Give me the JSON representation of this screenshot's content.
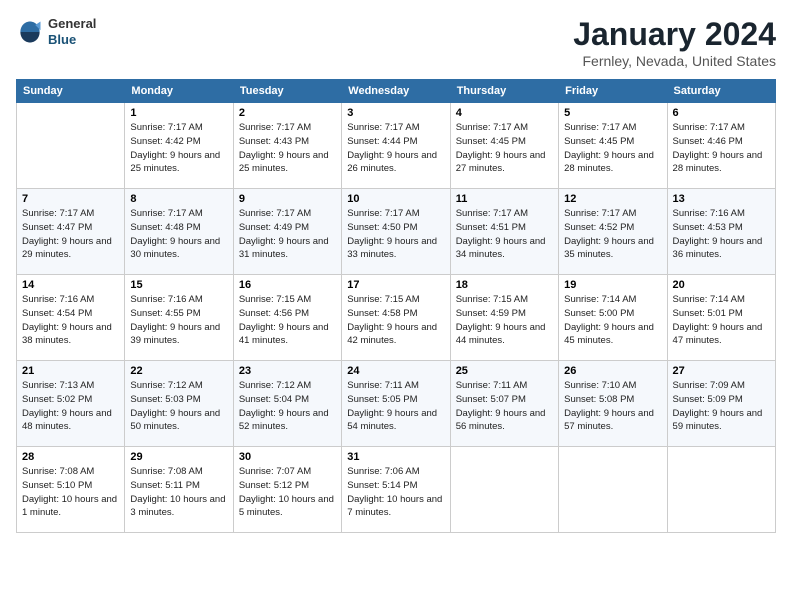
{
  "header": {
    "logo": {
      "general": "General",
      "blue": "Blue"
    },
    "title": "January 2024",
    "location": "Fernley, Nevada, United States"
  },
  "days_of_week": [
    "Sunday",
    "Monday",
    "Tuesday",
    "Wednesday",
    "Thursday",
    "Friday",
    "Saturday"
  ],
  "weeks": [
    [
      {
        "day": "",
        "sunrise": "",
        "sunset": "",
        "daylight": ""
      },
      {
        "day": "1",
        "sunrise": "Sunrise: 7:17 AM",
        "sunset": "Sunset: 4:42 PM",
        "daylight": "Daylight: 9 hours and 25 minutes."
      },
      {
        "day": "2",
        "sunrise": "Sunrise: 7:17 AM",
        "sunset": "Sunset: 4:43 PM",
        "daylight": "Daylight: 9 hours and 25 minutes."
      },
      {
        "day": "3",
        "sunrise": "Sunrise: 7:17 AM",
        "sunset": "Sunset: 4:44 PM",
        "daylight": "Daylight: 9 hours and 26 minutes."
      },
      {
        "day": "4",
        "sunrise": "Sunrise: 7:17 AM",
        "sunset": "Sunset: 4:45 PM",
        "daylight": "Daylight: 9 hours and 27 minutes."
      },
      {
        "day": "5",
        "sunrise": "Sunrise: 7:17 AM",
        "sunset": "Sunset: 4:45 PM",
        "daylight": "Daylight: 9 hours and 28 minutes."
      },
      {
        "day": "6",
        "sunrise": "Sunrise: 7:17 AM",
        "sunset": "Sunset: 4:46 PM",
        "daylight": "Daylight: 9 hours and 28 minutes."
      }
    ],
    [
      {
        "day": "7",
        "sunrise": "Sunrise: 7:17 AM",
        "sunset": "Sunset: 4:47 PM",
        "daylight": "Daylight: 9 hours and 29 minutes."
      },
      {
        "day": "8",
        "sunrise": "Sunrise: 7:17 AM",
        "sunset": "Sunset: 4:48 PM",
        "daylight": "Daylight: 9 hours and 30 minutes."
      },
      {
        "day": "9",
        "sunrise": "Sunrise: 7:17 AM",
        "sunset": "Sunset: 4:49 PM",
        "daylight": "Daylight: 9 hours and 31 minutes."
      },
      {
        "day": "10",
        "sunrise": "Sunrise: 7:17 AM",
        "sunset": "Sunset: 4:50 PM",
        "daylight": "Daylight: 9 hours and 33 minutes."
      },
      {
        "day": "11",
        "sunrise": "Sunrise: 7:17 AM",
        "sunset": "Sunset: 4:51 PM",
        "daylight": "Daylight: 9 hours and 34 minutes."
      },
      {
        "day": "12",
        "sunrise": "Sunrise: 7:17 AM",
        "sunset": "Sunset: 4:52 PM",
        "daylight": "Daylight: 9 hours and 35 minutes."
      },
      {
        "day": "13",
        "sunrise": "Sunrise: 7:16 AM",
        "sunset": "Sunset: 4:53 PM",
        "daylight": "Daylight: 9 hours and 36 minutes."
      }
    ],
    [
      {
        "day": "14",
        "sunrise": "Sunrise: 7:16 AM",
        "sunset": "Sunset: 4:54 PM",
        "daylight": "Daylight: 9 hours and 38 minutes."
      },
      {
        "day": "15",
        "sunrise": "Sunrise: 7:16 AM",
        "sunset": "Sunset: 4:55 PM",
        "daylight": "Daylight: 9 hours and 39 minutes."
      },
      {
        "day": "16",
        "sunrise": "Sunrise: 7:15 AM",
        "sunset": "Sunset: 4:56 PM",
        "daylight": "Daylight: 9 hours and 41 minutes."
      },
      {
        "day": "17",
        "sunrise": "Sunrise: 7:15 AM",
        "sunset": "Sunset: 4:58 PM",
        "daylight": "Daylight: 9 hours and 42 minutes."
      },
      {
        "day": "18",
        "sunrise": "Sunrise: 7:15 AM",
        "sunset": "Sunset: 4:59 PM",
        "daylight": "Daylight: 9 hours and 44 minutes."
      },
      {
        "day": "19",
        "sunrise": "Sunrise: 7:14 AM",
        "sunset": "Sunset: 5:00 PM",
        "daylight": "Daylight: 9 hours and 45 minutes."
      },
      {
        "day": "20",
        "sunrise": "Sunrise: 7:14 AM",
        "sunset": "Sunset: 5:01 PM",
        "daylight": "Daylight: 9 hours and 47 minutes."
      }
    ],
    [
      {
        "day": "21",
        "sunrise": "Sunrise: 7:13 AM",
        "sunset": "Sunset: 5:02 PM",
        "daylight": "Daylight: 9 hours and 48 minutes."
      },
      {
        "day": "22",
        "sunrise": "Sunrise: 7:12 AM",
        "sunset": "Sunset: 5:03 PM",
        "daylight": "Daylight: 9 hours and 50 minutes."
      },
      {
        "day": "23",
        "sunrise": "Sunrise: 7:12 AM",
        "sunset": "Sunset: 5:04 PM",
        "daylight": "Daylight: 9 hours and 52 minutes."
      },
      {
        "day": "24",
        "sunrise": "Sunrise: 7:11 AM",
        "sunset": "Sunset: 5:05 PM",
        "daylight": "Daylight: 9 hours and 54 minutes."
      },
      {
        "day": "25",
        "sunrise": "Sunrise: 7:11 AM",
        "sunset": "Sunset: 5:07 PM",
        "daylight": "Daylight: 9 hours and 56 minutes."
      },
      {
        "day": "26",
        "sunrise": "Sunrise: 7:10 AM",
        "sunset": "Sunset: 5:08 PM",
        "daylight": "Daylight: 9 hours and 57 minutes."
      },
      {
        "day": "27",
        "sunrise": "Sunrise: 7:09 AM",
        "sunset": "Sunset: 5:09 PM",
        "daylight": "Daylight: 9 hours and 59 minutes."
      }
    ],
    [
      {
        "day": "28",
        "sunrise": "Sunrise: 7:08 AM",
        "sunset": "Sunset: 5:10 PM",
        "daylight": "Daylight: 10 hours and 1 minute."
      },
      {
        "day": "29",
        "sunrise": "Sunrise: 7:08 AM",
        "sunset": "Sunset: 5:11 PM",
        "daylight": "Daylight: 10 hours and 3 minutes."
      },
      {
        "day": "30",
        "sunrise": "Sunrise: 7:07 AM",
        "sunset": "Sunset: 5:12 PM",
        "daylight": "Daylight: 10 hours and 5 minutes."
      },
      {
        "day": "31",
        "sunrise": "Sunrise: 7:06 AM",
        "sunset": "Sunset: 5:14 PM",
        "daylight": "Daylight: 10 hours and 7 minutes."
      },
      {
        "day": "",
        "sunrise": "",
        "sunset": "",
        "daylight": ""
      },
      {
        "day": "",
        "sunrise": "",
        "sunset": "",
        "daylight": ""
      },
      {
        "day": "",
        "sunrise": "",
        "sunset": "",
        "daylight": ""
      }
    ]
  ]
}
